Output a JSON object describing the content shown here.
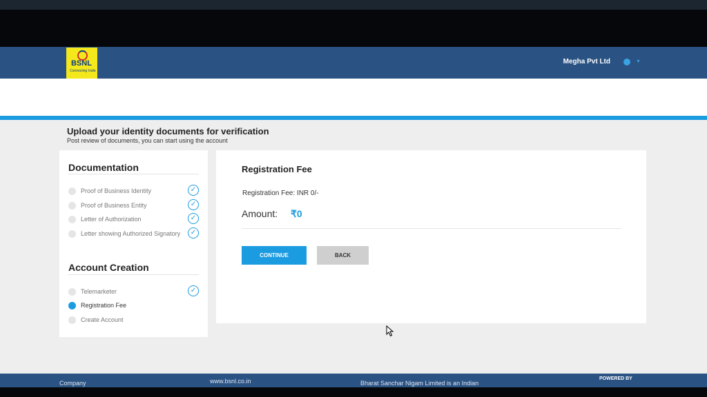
{
  "header": {
    "logo_text": "BSNL",
    "logo_tagline": "Connecting India",
    "user_name": "Megha Pvt Ltd"
  },
  "page": {
    "title": "Upload your identity documents for verification",
    "subtitle": "Post review of documents, you can start using the account"
  },
  "sidebar": {
    "documentation_title": "Documentation",
    "documentation_steps": [
      {
        "label": "Proof of Business Identity",
        "status": "done"
      },
      {
        "label": "Proof of Business Entity",
        "status": "done"
      },
      {
        "label": "Letter of Authorization",
        "status": "done"
      },
      {
        "label": "Letter showing Authorized Signatory",
        "status": "done"
      }
    ],
    "account_title": "Account Creation",
    "account_steps": [
      {
        "label": "Telemarketer",
        "status": "done"
      },
      {
        "label": "Registration Fee",
        "status": "active"
      },
      {
        "label": "Create Account",
        "status": "pending"
      }
    ]
  },
  "main": {
    "title": "Registration Fee",
    "fee_text": "Registration Fee: INR 0/-",
    "amount_label": "Amount:",
    "amount_value": "₹0",
    "continue_label": "CONTINUE",
    "back_label": "BACK"
  },
  "footer": {
    "company": "Company",
    "url": "www.bsnl.co.in",
    "description": "Bharat Sanchar Nigam Limited is an Indian",
    "powered_by": "POWERED BY"
  },
  "colors": {
    "header_blue": "#2a5283",
    "accent_blue": "#1b9be0",
    "logo_yellow": "#f4e81c"
  }
}
